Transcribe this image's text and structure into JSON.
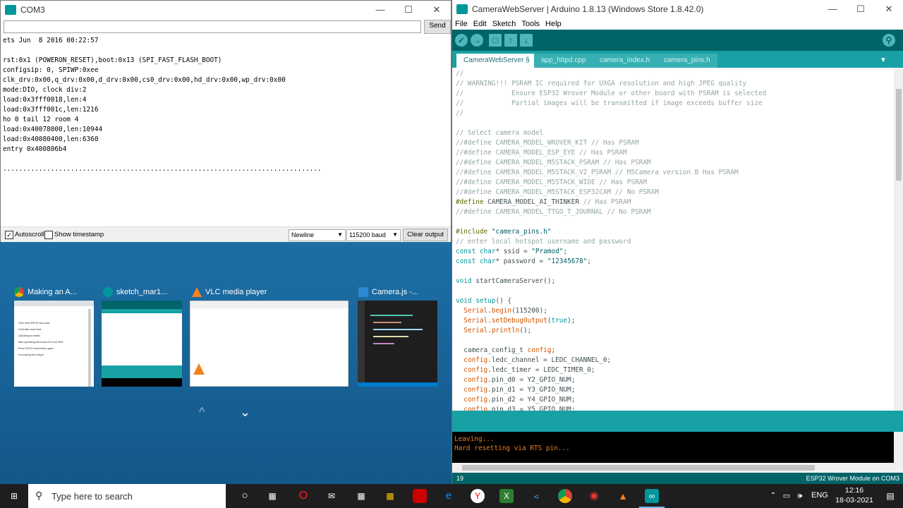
{
  "serial_monitor": {
    "title": "COM3",
    "send_label": "Send",
    "send_value": "",
    "output_lines": [
      "ets Jun  8 2016 00:22:57",
      "",
      "rst:0x1 (POWERON_RESET),boot:0x13 (SPI_FAST_FLASH_BOOT)",
      "configsip: 0, SPIWP:0xee",
      "clk_drv:0x00,q_drv:0x00,d_drv:0x00,cs0_drv:0x00,hd_drv:0x00,wp_drv:0x00",
      "mode:DIO, clock div:2",
      "load:0x3fff0018,len:4",
      "load:0x3fff001c,len:1216",
      "ho 0 tail 12 room 4",
      "load:0x40078000,len:10944",
      "load:0x40080400,len:6360",
      "entry 0x400806b4",
      "",
      "................................................................................"
    ],
    "autoscroll_label": "Autoscroll",
    "autoscroll_checked": true,
    "timestamp_label": "Show timestamp",
    "timestamp_checked": false,
    "line_ending": "Newline",
    "baud": "115200 baud",
    "clear_label": "Clear output"
  },
  "task_view": {
    "windows": [
      {
        "title": "Making an A...",
        "icon": "chrome-icon"
      },
      {
        "title": "sketch_mar1...",
        "icon": "arduino-icon"
      },
      {
        "title": "VLC media player",
        "icon": "vlc-icon"
      },
      {
        "title": "Camera.js -...",
        "icon": "vscode-icon"
      }
    ],
    "thumb1_lines": [
      "Then reset ESP32 and close",
      "It will take some time",
      "Uploading is started",
      "After uploading disconnect IO0 and GND",
      "Press ESP32 reset button again",
      "It is making the hotspot"
    ]
  },
  "ide": {
    "title": "CameraWebServer | Arduino 1.8.13 (Windows Store 1.8.42.0)",
    "menu": [
      "File",
      "Edit",
      "Sketch",
      "Tools",
      "Help"
    ],
    "tabs": [
      "CameraWebServer §",
      "app_httpd.cpp",
      "camera_index.h",
      "camera_pins.h"
    ],
    "console_lines": [
      "Leaving...",
      "Hard resetting via RTS pin..."
    ],
    "line_number": "19",
    "board_status": "ESP32 Wrover Module on COM3"
  },
  "taskbar": {
    "search_placeholder": "Type here to search",
    "language": "ENG",
    "time": "12:16",
    "date": "18-03-2021"
  },
  "colors": {
    "arduino_teal": "#17a1a5",
    "arduino_dark": "#006468",
    "console_text": "#e67e22"
  }
}
